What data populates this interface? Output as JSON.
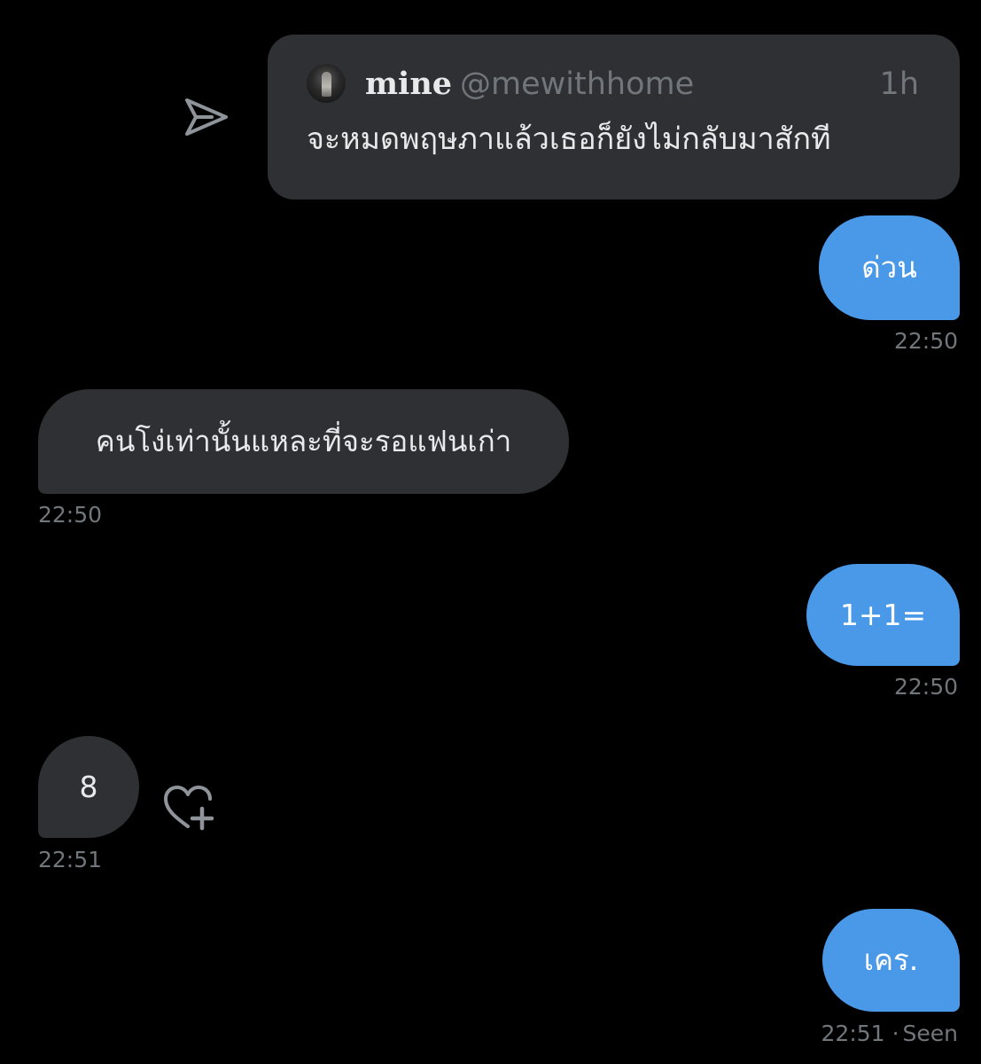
{
  "colors": {
    "background": "#000000",
    "sent_bubble": "#4a99e9",
    "received_bubble": "#2f3033",
    "secondary_text": "#71767b",
    "primary_text": "#e7e9ea"
  },
  "shared_tweet": {
    "icon": "share-arrow-icon",
    "author_name": "mine",
    "author_handle": "@mewithhome",
    "time_ago": "1h",
    "text": "จะหมดพฤษภาแล้วเธอก็ยังไม่กลับมาสักที"
  },
  "messages": [
    {
      "direction": "sent",
      "text": "ด่วน",
      "time": "22:50"
    },
    {
      "direction": "received",
      "text": "คนโง่เท่านั้นแหละที่จะรอแฟนเก่า",
      "time": "22:50"
    },
    {
      "direction": "sent",
      "text": "1+1=",
      "time": "22:50"
    },
    {
      "direction": "received",
      "text": "8",
      "time": "22:51",
      "reaction_icon": "heart-plus-icon"
    },
    {
      "direction": "sent",
      "text": "เคร.",
      "time": "22:51",
      "separator": "·",
      "status": "Seen"
    }
  ]
}
